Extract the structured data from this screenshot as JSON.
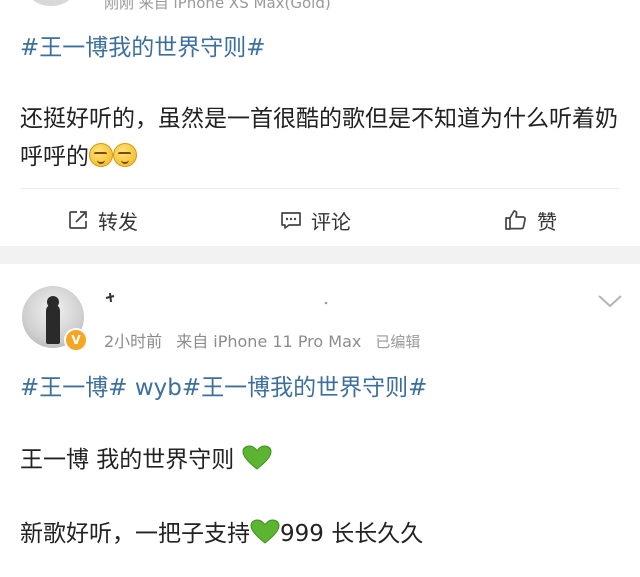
{
  "post1": {
    "meta_partial": "刚刚  来自 iPhone XS Max(Gold)",
    "hashtag": "#王一博我的世界守则#",
    "text": "还挺好听的，虽然是一首很酷的歌但是不知道为什么听着奶呼呼的",
    "actions": {
      "share_label": "转发",
      "comment_label": "评论",
      "like_label": "赞"
    }
  },
  "post2": {
    "verified_badge": "V",
    "time": "2小时前",
    "source": "来自 iPhone 11 Pro Max",
    "edited": "已编辑",
    "tag1": "#王一博#",
    "plain": " wyb",
    "tag2": "#王一博我的世界守则#",
    "line1": "王一博 我的世界守则 ",
    "line2_a": "新歌好听，一把子支持",
    "line2_b": "999 长长久久"
  },
  "colors": {
    "link": "#3d6f9e",
    "text": "#222222",
    "meta": "#8c8c8c",
    "separator": "#f2f2f2",
    "heart": "#5cb531",
    "badge": "#f5a623"
  },
  "icons": [
    "share-icon",
    "comment-icon",
    "like-icon",
    "chevron-down-icon",
    "green-heart-icon",
    "dizzy-face-emoji"
  ]
}
